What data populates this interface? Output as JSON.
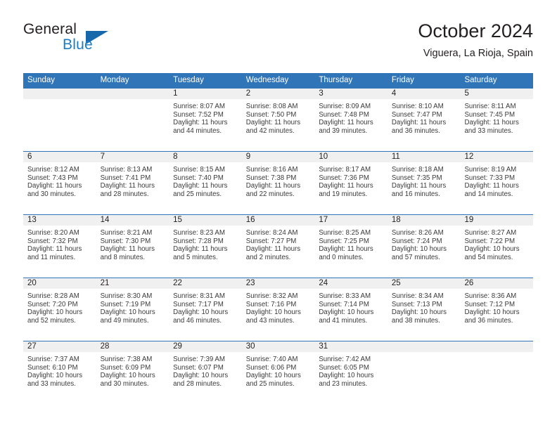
{
  "brand": {
    "name_part1": "General",
    "name_part2": "Blue",
    "flag_icon": "triangle-flag-icon",
    "accent_color": "#1b7dc4"
  },
  "header": {
    "title": "October 2024",
    "location": "Viguera, La Rioja, Spain"
  },
  "theme": {
    "header_blue": "#3075b8",
    "day_band_gray": "#f0f0f0",
    "text": "#231f20"
  },
  "weekdays": [
    "Sunday",
    "Monday",
    "Tuesday",
    "Wednesday",
    "Thursday",
    "Friday",
    "Saturday"
  ],
  "weeks": [
    [
      {
        "empty": true
      },
      {
        "empty": true
      },
      {
        "day": "1",
        "sunrise": "Sunrise: 8:07 AM",
        "sunset": "Sunset: 7:52 PM",
        "daylight_line1": "Daylight: 11 hours",
        "daylight_line2": "and 44 minutes."
      },
      {
        "day": "2",
        "sunrise": "Sunrise: 8:08 AM",
        "sunset": "Sunset: 7:50 PM",
        "daylight_line1": "Daylight: 11 hours",
        "daylight_line2": "and 42 minutes."
      },
      {
        "day": "3",
        "sunrise": "Sunrise: 8:09 AM",
        "sunset": "Sunset: 7:48 PM",
        "daylight_line1": "Daylight: 11 hours",
        "daylight_line2": "and 39 minutes."
      },
      {
        "day": "4",
        "sunrise": "Sunrise: 8:10 AM",
        "sunset": "Sunset: 7:47 PM",
        "daylight_line1": "Daylight: 11 hours",
        "daylight_line2": "and 36 minutes."
      },
      {
        "day": "5",
        "sunrise": "Sunrise: 8:11 AM",
        "sunset": "Sunset: 7:45 PM",
        "daylight_line1": "Daylight: 11 hours",
        "daylight_line2": "and 33 minutes."
      }
    ],
    [
      {
        "day": "6",
        "sunrise": "Sunrise: 8:12 AM",
        "sunset": "Sunset: 7:43 PM",
        "daylight_line1": "Daylight: 11 hours",
        "daylight_line2": "and 30 minutes."
      },
      {
        "day": "7",
        "sunrise": "Sunrise: 8:13 AM",
        "sunset": "Sunset: 7:41 PM",
        "daylight_line1": "Daylight: 11 hours",
        "daylight_line2": "and 28 minutes."
      },
      {
        "day": "8",
        "sunrise": "Sunrise: 8:15 AM",
        "sunset": "Sunset: 7:40 PM",
        "daylight_line1": "Daylight: 11 hours",
        "daylight_line2": "and 25 minutes."
      },
      {
        "day": "9",
        "sunrise": "Sunrise: 8:16 AM",
        "sunset": "Sunset: 7:38 PM",
        "daylight_line1": "Daylight: 11 hours",
        "daylight_line2": "and 22 minutes."
      },
      {
        "day": "10",
        "sunrise": "Sunrise: 8:17 AM",
        "sunset": "Sunset: 7:36 PM",
        "daylight_line1": "Daylight: 11 hours",
        "daylight_line2": "and 19 minutes."
      },
      {
        "day": "11",
        "sunrise": "Sunrise: 8:18 AM",
        "sunset": "Sunset: 7:35 PM",
        "daylight_line1": "Daylight: 11 hours",
        "daylight_line2": "and 16 minutes."
      },
      {
        "day": "12",
        "sunrise": "Sunrise: 8:19 AM",
        "sunset": "Sunset: 7:33 PM",
        "daylight_line1": "Daylight: 11 hours",
        "daylight_line2": "and 14 minutes."
      }
    ],
    [
      {
        "day": "13",
        "sunrise": "Sunrise: 8:20 AM",
        "sunset": "Sunset: 7:32 PM",
        "daylight_line1": "Daylight: 11 hours",
        "daylight_line2": "and 11 minutes."
      },
      {
        "day": "14",
        "sunrise": "Sunrise: 8:21 AM",
        "sunset": "Sunset: 7:30 PM",
        "daylight_line1": "Daylight: 11 hours",
        "daylight_line2": "and 8 minutes."
      },
      {
        "day": "15",
        "sunrise": "Sunrise: 8:23 AM",
        "sunset": "Sunset: 7:28 PM",
        "daylight_line1": "Daylight: 11 hours",
        "daylight_line2": "and 5 minutes."
      },
      {
        "day": "16",
        "sunrise": "Sunrise: 8:24 AM",
        "sunset": "Sunset: 7:27 PM",
        "daylight_line1": "Daylight: 11 hours",
        "daylight_line2": "and 2 minutes."
      },
      {
        "day": "17",
        "sunrise": "Sunrise: 8:25 AM",
        "sunset": "Sunset: 7:25 PM",
        "daylight_line1": "Daylight: 11 hours",
        "daylight_line2": "and 0 minutes."
      },
      {
        "day": "18",
        "sunrise": "Sunrise: 8:26 AM",
        "sunset": "Sunset: 7:24 PM",
        "daylight_line1": "Daylight: 10 hours",
        "daylight_line2": "and 57 minutes."
      },
      {
        "day": "19",
        "sunrise": "Sunrise: 8:27 AM",
        "sunset": "Sunset: 7:22 PM",
        "daylight_line1": "Daylight: 10 hours",
        "daylight_line2": "and 54 minutes."
      }
    ],
    [
      {
        "day": "20",
        "sunrise": "Sunrise: 8:28 AM",
        "sunset": "Sunset: 7:20 PM",
        "daylight_line1": "Daylight: 10 hours",
        "daylight_line2": "and 52 minutes."
      },
      {
        "day": "21",
        "sunrise": "Sunrise: 8:30 AM",
        "sunset": "Sunset: 7:19 PM",
        "daylight_line1": "Daylight: 10 hours",
        "daylight_line2": "and 49 minutes."
      },
      {
        "day": "22",
        "sunrise": "Sunrise: 8:31 AM",
        "sunset": "Sunset: 7:17 PM",
        "daylight_line1": "Daylight: 10 hours",
        "daylight_line2": "and 46 minutes."
      },
      {
        "day": "23",
        "sunrise": "Sunrise: 8:32 AM",
        "sunset": "Sunset: 7:16 PM",
        "daylight_line1": "Daylight: 10 hours",
        "daylight_line2": "and 43 minutes."
      },
      {
        "day": "24",
        "sunrise": "Sunrise: 8:33 AM",
        "sunset": "Sunset: 7:14 PM",
        "daylight_line1": "Daylight: 10 hours",
        "daylight_line2": "and 41 minutes."
      },
      {
        "day": "25",
        "sunrise": "Sunrise: 8:34 AM",
        "sunset": "Sunset: 7:13 PM",
        "daylight_line1": "Daylight: 10 hours",
        "daylight_line2": "and 38 minutes."
      },
      {
        "day": "26",
        "sunrise": "Sunrise: 8:36 AM",
        "sunset": "Sunset: 7:12 PM",
        "daylight_line1": "Daylight: 10 hours",
        "daylight_line2": "and 36 minutes."
      }
    ],
    [
      {
        "day": "27",
        "sunrise": "Sunrise: 7:37 AM",
        "sunset": "Sunset: 6:10 PM",
        "daylight_line1": "Daylight: 10 hours",
        "daylight_line2": "and 33 minutes."
      },
      {
        "day": "28",
        "sunrise": "Sunrise: 7:38 AM",
        "sunset": "Sunset: 6:09 PM",
        "daylight_line1": "Daylight: 10 hours",
        "daylight_line2": "and 30 minutes."
      },
      {
        "day": "29",
        "sunrise": "Sunrise: 7:39 AM",
        "sunset": "Sunset: 6:07 PM",
        "daylight_line1": "Daylight: 10 hours",
        "daylight_line2": "and 28 minutes."
      },
      {
        "day": "30",
        "sunrise": "Sunrise: 7:40 AM",
        "sunset": "Sunset: 6:06 PM",
        "daylight_line1": "Daylight: 10 hours",
        "daylight_line2": "and 25 minutes."
      },
      {
        "day": "31",
        "sunrise": "Sunrise: 7:42 AM",
        "sunset": "Sunset: 6:05 PM",
        "daylight_line1": "Daylight: 10 hours",
        "daylight_line2": "and 23 minutes."
      },
      {
        "empty": true
      },
      {
        "empty": true
      }
    ]
  ]
}
